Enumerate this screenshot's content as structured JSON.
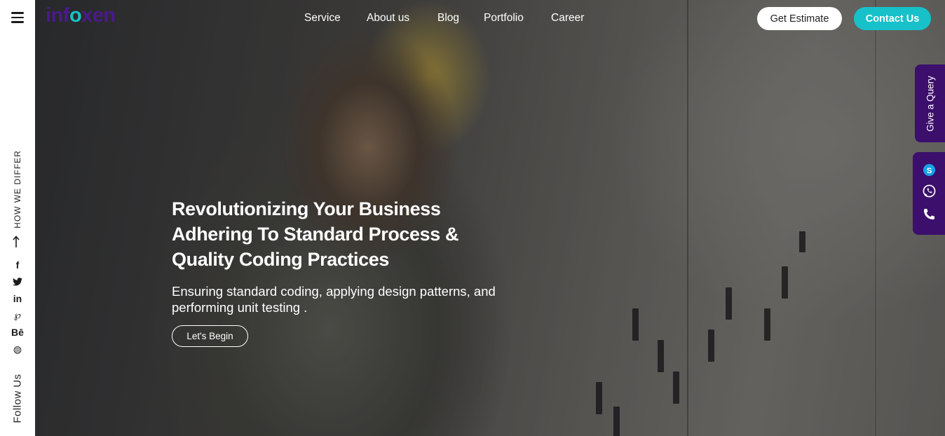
{
  "brand": {
    "logo_prefix": "inf",
    "logo_accent": "o",
    "logo_suffix": "xen",
    "primary_color": "#4a1a8c",
    "accent_color": "#17c1c9"
  },
  "nav": {
    "items": [
      {
        "label": "Service"
      },
      {
        "label": "About us"
      },
      {
        "label": "Blog"
      },
      {
        "label": "Portfolio"
      },
      {
        "label": "Career"
      }
    ],
    "estimate_label": "Get Estimate",
    "contact_label": "Contact Us"
  },
  "sidebar": {
    "menu_icon": "hamburger-icon",
    "differ_label": "HOW WE DIFFER",
    "follow_label": "Follow Us",
    "socials": [
      {
        "name": "facebook-icon",
        "glyph": "f"
      },
      {
        "name": "twitter-icon",
        "glyph": "🐦"
      },
      {
        "name": "linkedin-icon",
        "glyph": "in"
      },
      {
        "name": "pinterest-icon",
        "glyph": "℘"
      },
      {
        "name": "behance-icon",
        "glyph": "Bē"
      },
      {
        "name": "dribbble-icon",
        "glyph": "◍"
      }
    ]
  },
  "hero": {
    "title_line1": "Revolutionizing Your Business",
    "title_line2": "Adhering To Standard Process &",
    "title_line3": "Quality Coding Practices",
    "subtitle": "Ensuring standard coding, applying design patterns, and performing unit testing .",
    "cta_label": "Let's Begin"
  },
  "right_tabs": {
    "query_label": "Give a Query",
    "contact_icons": [
      "skype-icon",
      "whatsapp-icon",
      "phone-icon"
    ],
    "tab_color": "#3b0f6b"
  }
}
